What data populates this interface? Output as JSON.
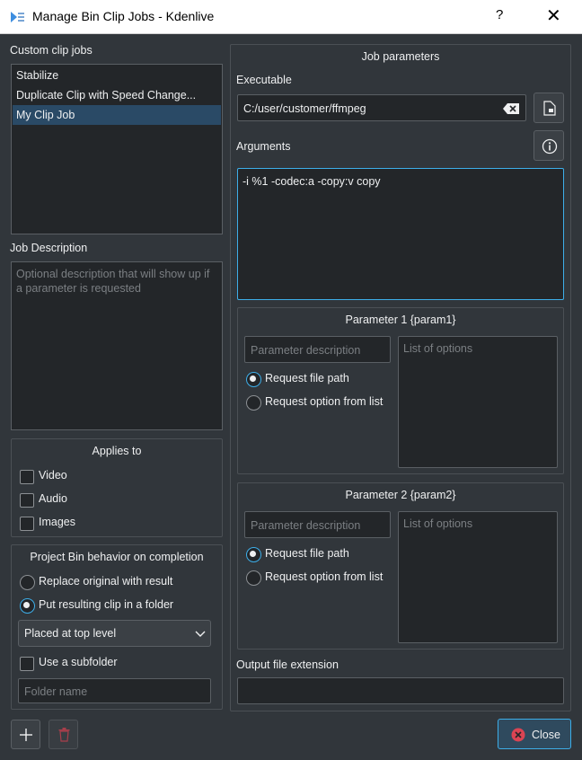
{
  "window": {
    "title": "Manage Bin Clip Jobs - Kdenlive",
    "help": "?",
    "close": "✕"
  },
  "left": {
    "custom_jobs_label": "Custom clip jobs",
    "jobs": [
      "Stabilize",
      "Duplicate Clip with Speed Change...",
      "My Clip Job"
    ],
    "description_label": "Job Description",
    "description_placeholder": "Optional description that will show up if a parameter is requested",
    "applies_to": {
      "title": "Applies to",
      "options": [
        "Video",
        "Audio",
        "Images"
      ]
    },
    "bin_behavior": {
      "title": "Project Bin behavior on completion",
      "replace": "Replace original with result",
      "put_folder": "Put resulting clip in a folder",
      "placement": "Placed at top level",
      "subfolder": "Use a subfolder",
      "folder_placeholder": "Folder name"
    }
  },
  "right": {
    "title": "Job parameters",
    "executable_label": "Executable",
    "executable_value": "C:/user/customer/ffmpeg",
    "arguments_label": "Arguments",
    "arguments_value": "-i %1 -codec:a -copy:v copy",
    "param1": {
      "title": "Parameter 1 {param1}",
      "desc_placeholder": "Parameter description",
      "file": "Request file path",
      "list": "Request option from list",
      "options_placeholder": "List of options"
    },
    "param2": {
      "title": "Parameter 2 {param2}",
      "desc_placeholder": "Parameter description",
      "file": "Request file path",
      "list": "Request option from list",
      "options_placeholder": "List of options"
    },
    "output_ext_label": "Output file extension"
  },
  "footer": {
    "close_label": "Close",
    "add_icon": "plus-icon",
    "delete_icon": "trash-icon"
  },
  "colors": {
    "bg": "#31363b",
    "field": "#232629",
    "accent": "#3daee9",
    "selection": "#2a4a66",
    "danger": "#da4453"
  }
}
